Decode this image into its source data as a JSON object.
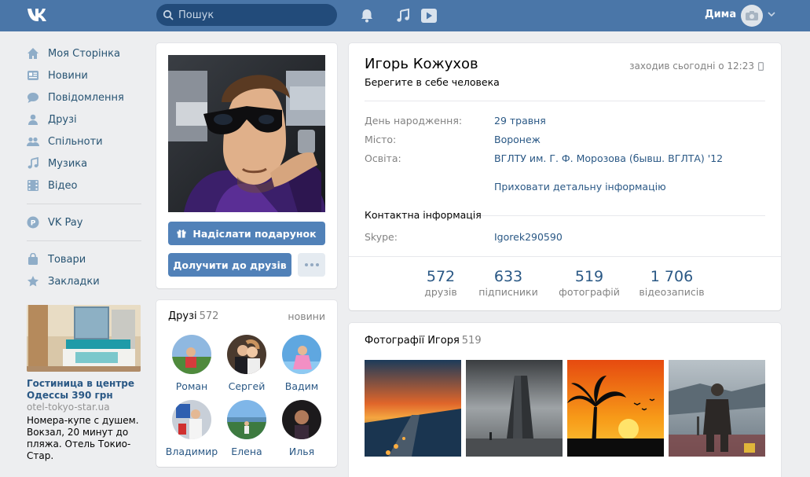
{
  "colors": {
    "header": "#4a76a8",
    "link": "#2a5885",
    "button": "#5181b8",
    "muted": "#828282",
    "background": "#edeef0"
  },
  "header": {
    "logo_icon": "vk-logo-icon",
    "search_placeholder": "Пошук",
    "icons": [
      "bell-icon",
      "music-note-icon",
      "play-icon"
    ],
    "user_name": "Дима"
  },
  "menu": {
    "items": [
      {
        "label": "Моя Сторінка",
        "icon": "home-icon"
      },
      {
        "label": "Новини",
        "icon": "news-icon"
      },
      {
        "label": "Повідомлення",
        "icon": "messages-icon"
      },
      {
        "label": "Друзі",
        "icon": "friend-icon"
      },
      {
        "label": "Спільноти",
        "icon": "communities-icon"
      },
      {
        "label": "Музика",
        "icon": "music-icon"
      },
      {
        "label": "Відео",
        "icon": "video-icon"
      }
    ],
    "pay": {
      "label": "VK Pay",
      "icon": "vkpay-icon"
    },
    "extra": [
      {
        "label": "Товари",
        "icon": "bag-icon"
      },
      {
        "label": "Закладки",
        "icon": "star-icon"
      }
    ]
  },
  "ad": {
    "title": "Гостиница в центре Одессы 390 грн",
    "domain": "otel-tokyo-star.ua",
    "text": "Номера-купе с душем. Вокзал, 20 минут до пляжа. Отель Токио-Стар."
  },
  "profile": {
    "name": "Игорь Кожухов",
    "status": "Берегите в себе человека",
    "online": "заходив сьогодні о 12:23",
    "gift_button": "Надіслати подарунок",
    "add_button": "Долучити до друзів",
    "info": [
      {
        "label": "День народження:",
        "value": "29 травня"
      },
      {
        "label": "Місто:",
        "value": "Воронеж"
      },
      {
        "label": "Освіта:",
        "value": "ВГЛТУ им. Г. Ф. Морозова (бывш. ВГЛТА) '12"
      }
    ],
    "hide_link": "Приховати детальну інформацію",
    "contact_header": "Контактна інформація",
    "contacts": [
      {
        "label": "Skype:",
        "value": "Igorek290590"
      }
    ],
    "counters": [
      {
        "num": "572",
        "label": "друзів"
      },
      {
        "num": "633",
        "label": "підписники"
      },
      {
        "num": "519",
        "label": "фотографій"
      },
      {
        "num": "1 706",
        "label": "відеозаписів"
      }
    ]
  },
  "friends": {
    "title": "Друзі",
    "count": "572",
    "new_link": "новини",
    "list": [
      "Роман",
      "Сергей",
      "Вадим",
      "Владимир",
      "Елена",
      "Илья"
    ]
  },
  "photos": {
    "title": "Фотографії Игоря",
    "count": "519"
  }
}
